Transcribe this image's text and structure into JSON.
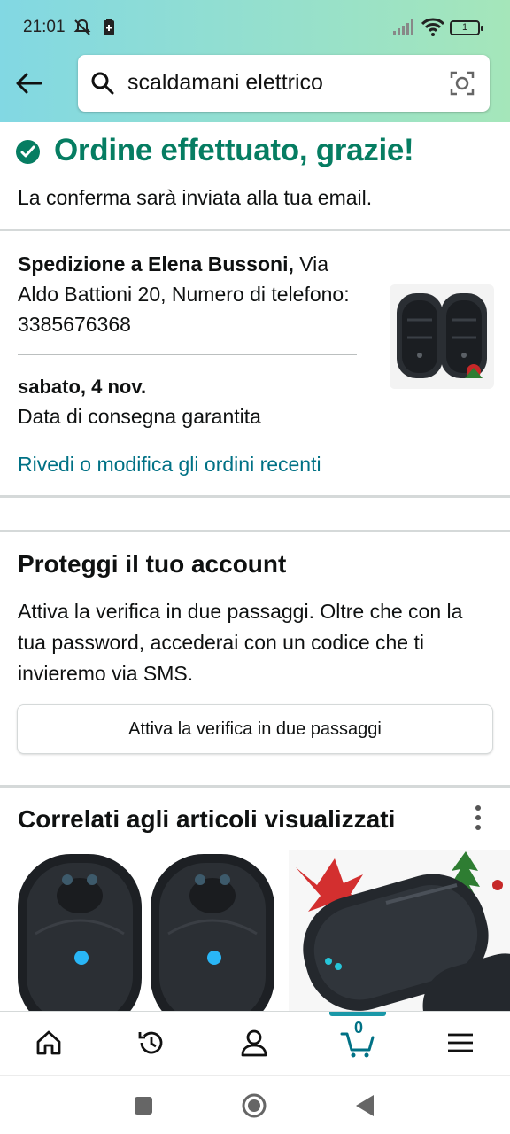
{
  "status_bar": {
    "time": "21:01",
    "battery": "1"
  },
  "header": {
    "search_query": "scaldamani elettrico"
  },
  "confirmation": {
    "title": "Ordine effettuato, grazie!",
    "subtitle": "La conferma sarà inviata alla tua email."
  },
  "shipping": {
    "recipient_label": "Spedizione a Elena Bussoni,",
    "address": " Via Aldo Battioni 20, Numero di telefono: 3385676368",
    "date": "sabato, 4 nov.",
    "guarantee": "Data di consegna garantita",
    "review_link": "Rivedi o modifica gli ordini recenti"
  },
  "protect": {
    "title": "Proteggi il tuo account",
    "description": "Attiva la verifica in due passaggi. Oltre che con la tua password, accederai con un codice che ti invieremo via SMS.",
    "button_label": "Attiva la verifica in due passaggi"
  },
  "related": {
    "title": "Correlati agli articoli visualizzati"
  },
  "bottom_nav": {
    "items": [
      {
        "icon": "home-icon"
      },
      {
        "icon": "history-icon"
      },
      {
        "icon": "account-icon"
      },
      {
        "icon": "cart-icon",
        "count": "0",
        "active": true
      },
      {
        "icon": "menu-icon"
      }
    ]
  },
  "colors": {
    "success": "#067d62",
    "link": "#007185",
    "accent": "#1a98a8"
  }
}
